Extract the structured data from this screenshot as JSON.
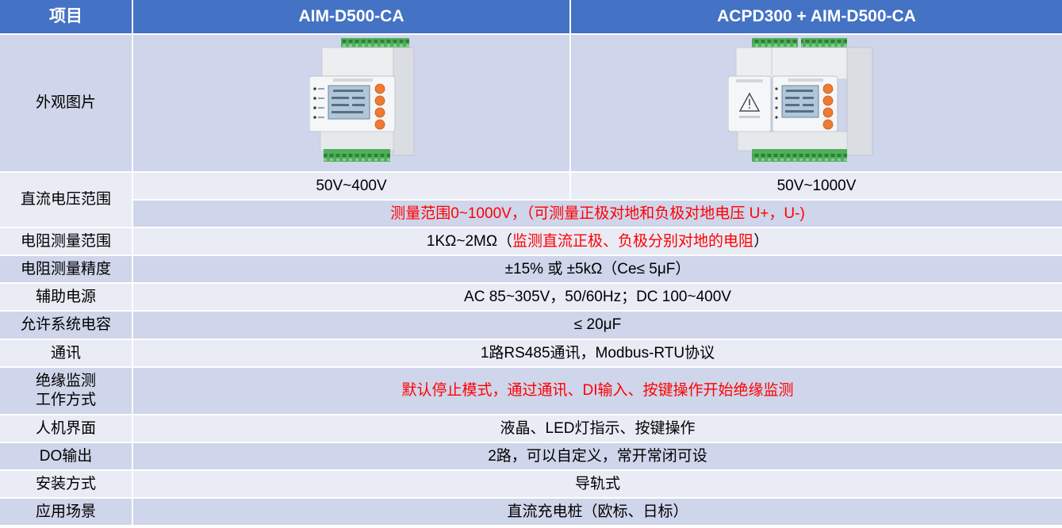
{
  "colors": {
    "header_bg": "#4472C4",
    "header_text": "#FFFFFF",
    "band_dark": "#CFD5EA",
    "band_light": "#E9EBF5",
    "body_text": "#000000",
    "highlight_text": "#FF0000",
    "terminal_green": "#4FAF5B",
    "button_orange": "#EE7B32",
    "lcd_screen": "#AFC7DA"
  },
  "header": {
    "item": "项目",
    "model_a": "AIM-D500-CA",
    "model_b": "ACPD300 + AIM-D500-CA"
  },
  "rows": {
    "appearance": {
      "label": "外观图片"
    },
    "dc_voltage": {
      "label": "直流电压范围",
      "model_a": "50V~400V",
      "model_b": "50V~1000V",
      "note": "测量范围0~1000V，（可测量正极对地和负极对地电压 U+，U-)"
    },
    "resistance_range": {
      "label": "电阻测量范围",
      "value_prefix": "1KΩ~2MΩ（",
      "value_highlight": "监测直流正极、负极分别对地的电阻",
      "value_suffix": "）"
    },
    "resistance_accuracy": {
      "label": "电阻测量精度",
      "value": "±15% 或 ±5kΩ（Ce≤ 5μF）"
    },
    "aux_power": {
      "label": "辅助电源",
      "value": "AC 85~305V，50/60Hz；DC 100~400V"
    },
    "system_capacitance": {
      "label": "允许系统电容",
      "value": "≤ 20μF"
    },
    "communication": {
      "label": "通讯",
      "value": "1路RS485通讯，Modbus-RTU协议"
    },
    "insulation_mode": {
      "label_line1": "绝缘监测",
      "label_line2": "工作方式",
      "value": "默认停止模式，通过通讯、DI输入、按键操作开始绝缘监测"
    },
    "hmi": {
      "label": "人机界面",
      "value": "液晶、LED灯指示、按键操作"
    },
    "do_output": {
      "label": "DO输出",
      "value": "2路，可以自定义，常开常闭可设"
    },
    "installation": {
      "label": "安装方式",
      "value": "导轨式"
    },
    "application": {
      "label": "应用场景",
      "value": "直流充电桩（欧标、日标）"
    }
  }
}
